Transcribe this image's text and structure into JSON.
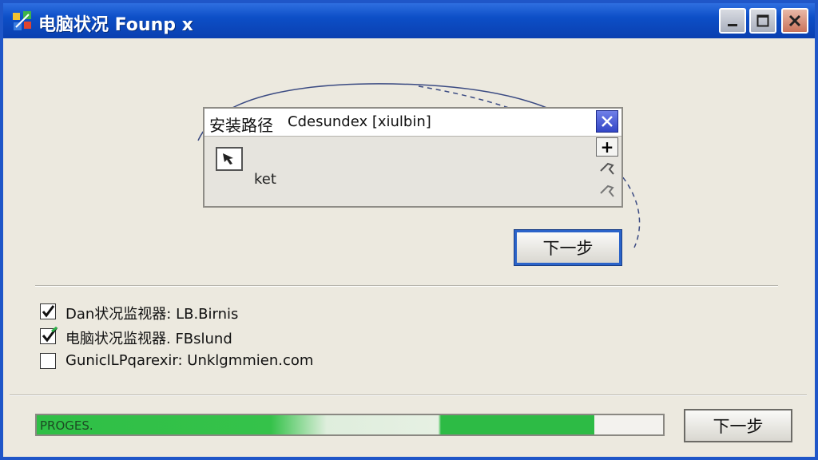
{
  "window": {
    "title": "电脑状况 Founp x"
  },
  "path_panel": {
    "label": "安装路径",
    "value": "Cdesundex [xiulbin]",
    "item_label": "ket",
    "plus_label": "+"
  },
  "next_button_label": "下一步",
  "options": [
    {
      "label": "Dan状况监视器: LB.Birnis",
      "checked": true
    },
    {
      "label": "电脑状况监视器. FBslund",
      "checked": true
    },
    {
      "label": "GuniclLPqarexir: Unklgmmien.com",
      "checked": false
    }
  ],
  "progress": {
    "text": "PROGES.",
    "fraction": 0.89
  },
  "bottom_button_label": "下一步",
  "colors": {
    "title_bar": "#0d4fc7",
    "progress_green": "#2fbf46",
    "focus_blue": "#2a63c9"
  },
  "icons": {
    "app": "app-icon",
    "minimize": "minimize-icon",
    "maximize": "maximize-icon",
    "close": "close-icon",
    "panel_close": "close-icon",
    "item": "folder-cursor-icon",
    "tool1": "pin-icon",
    "tool2": "pin-icon"
  }
}
